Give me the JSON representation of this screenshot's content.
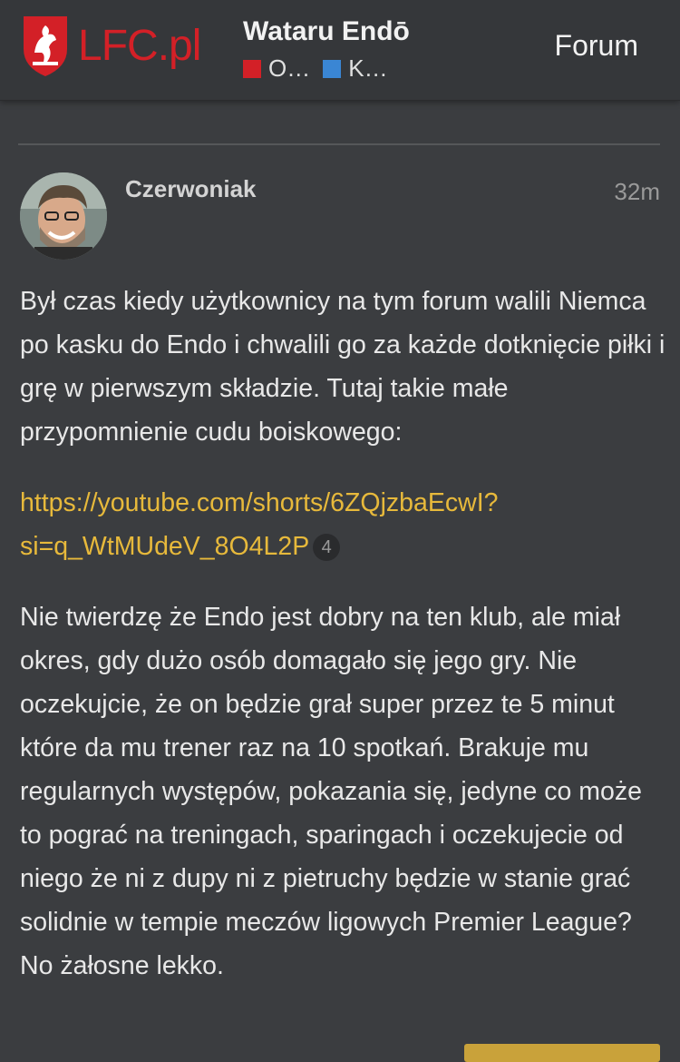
{
  "header": {
    "logo_text": "LFC",
    "logo_dot": ".",
    "logo_suffix": "pl",
    "topic_title": "Wataru Endō",
    "categories": [
      {
        "label": "O…",
        "color": "#d32027"
      },
      {
        "label": "K…",
        "color": "#3a86d4"
      }
    ],
    "forum_link": "Forum"
  },
  "post": {
    "username": "Czerwoniak",
    "time": "32m",
    "paragraph1": "Był czas kiedy użytkownicy na tym forum walili Niemca po kasku do Endo i chwalili go za każde dotknięcie piłki i grę w pierwszym składzie. Tutaj takie małe przypomnienie cudu boiskowego:",
    "link_text": "https://youtube.com/shorts/6ZQjzbaEcwI?si=q_WtMUdeV_8O4L2P",
    "link_clicks": "4",
    "paragraph2": "Nie twierdzę że Endo jest dobry na ten klub, ale miał okres, gdy dużo osób domagało się jego gry. Nie oczekujcie, że on będzie grał super przez te 5 minut które da mu trener raz na 10 spotkań. Brakuje mu regularnych występów, pokazania się, jedyne co może to pograć na treningach, sparingach i oczekujecie od niego że ni z dupy ni z pietruchy będzie w stanie grać solidnie w tempie meczów ligowych Premier League? No żałosne lekko."
  },
  "colors": {
    "background": "#3b3d40",
    "link": "#e7b93b",
    "brand_red": "#d32027"
  }
}
